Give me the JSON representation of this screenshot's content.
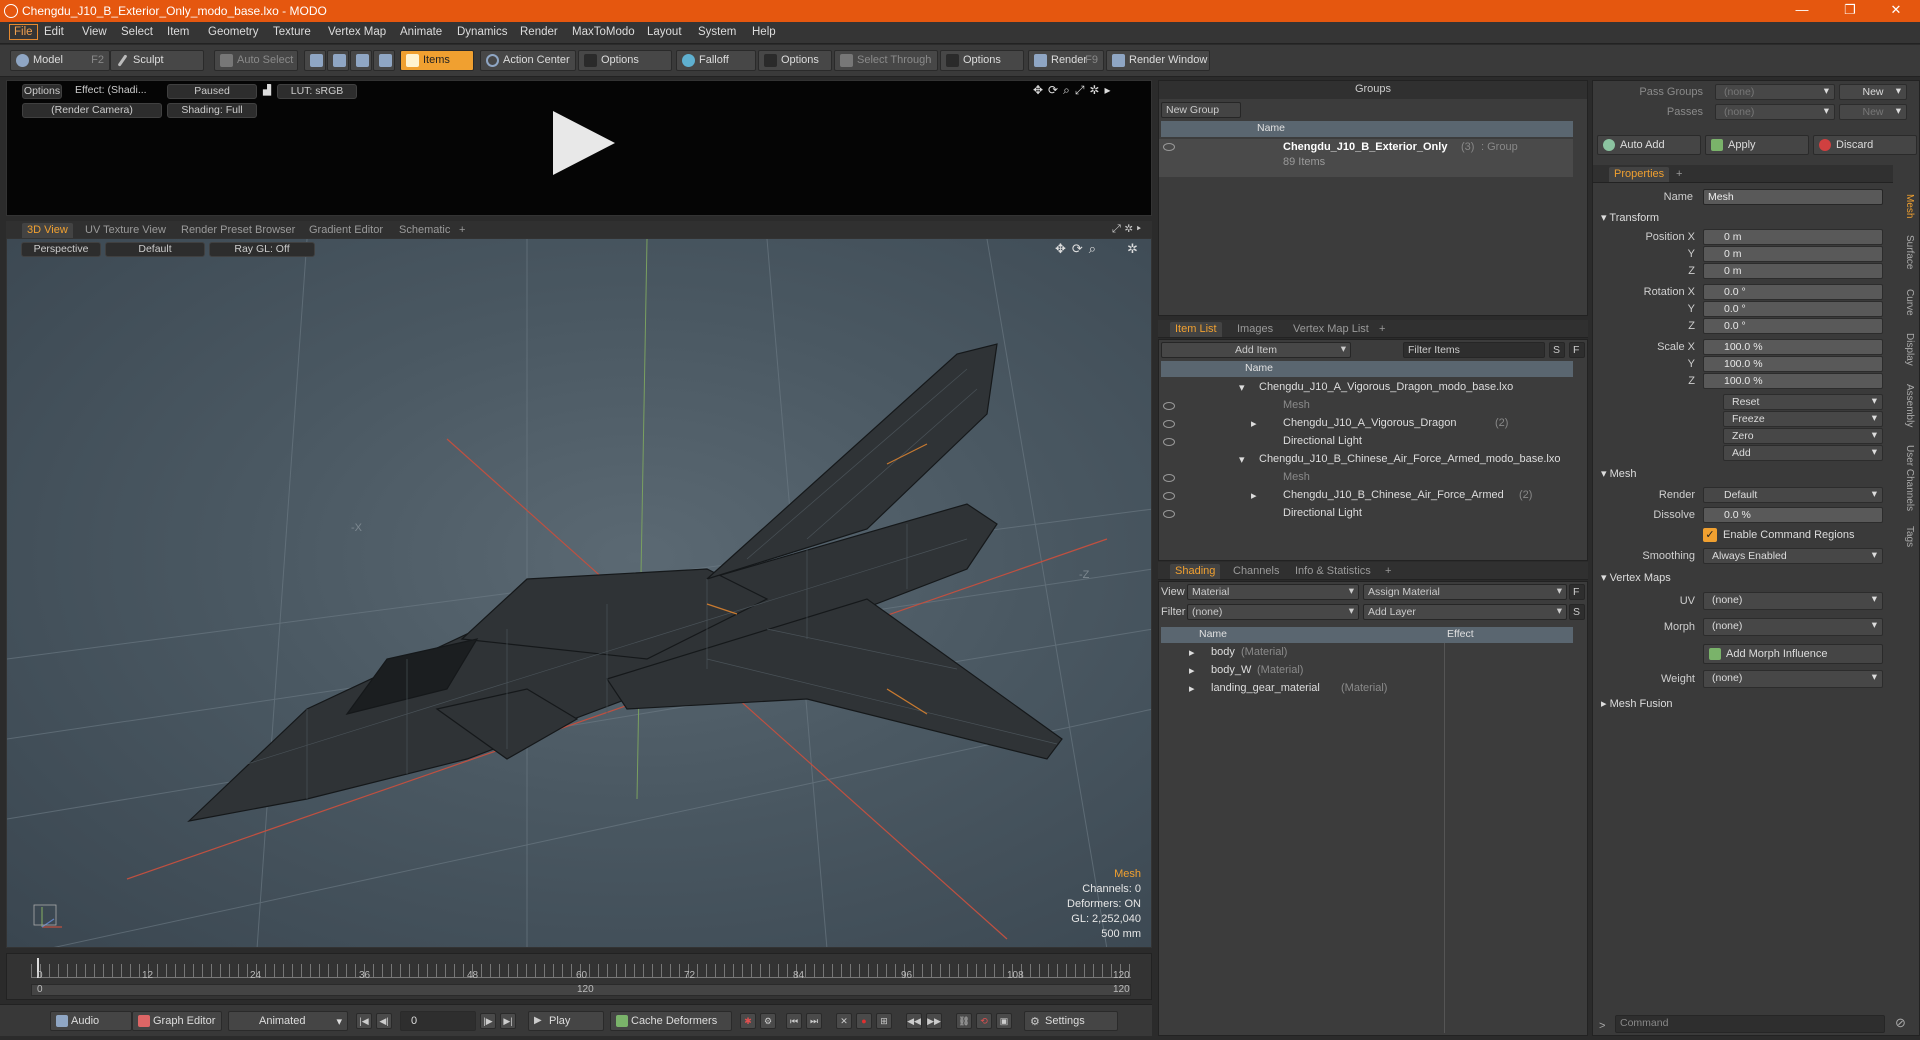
{
  "window": {
    "title": "Chengdu_J10_B_Exterior_Only_modo_base.lxo - MODO",
    "minimize": "—",
    "maximize": "❐",
    "close": "✕"
  },
  "menu": [
    "File",
    "Edit",
    "View",
    "Select",
    "Item",
    "Geometry",
    "Texture",
    "Vertex Map",
    "Animate",
    "Dynamics",
    "Render",
    "MaxToModo",
    "Layout",
    "System",
    "Help"
  ],
  "toolbar": {
    "model": "Model",
    "model_key": "F2",
    "sculpt": "Sculpt",
    "auto_select": "Auto Select",
    "items": "Items",
    "action_center": "Action Center",
    "options1": "Options",
    "falloff": "Falloff",
    "options2": "Options",
    "select_through": "Select Through",
    "options3": "Options",
    "render": "Render",
    "render_key": "F9",
    "render_window": "Render Window"
  },
  "preview": {
    "options": "Options",
    "effect": "Effect: (Shadi...",
    "paused": "Paused",
    "lut": "LUT: sRGB",
    "camera": "(Render Camera)",
    "shading": "Shading: Full"
  },
  "viewport_tabs": [
    "3D View",
    "UV Texture View",
    "Render Preset Browser",
    "Gradient Editor",
    "Schematic",
    "+"
  ],
  "viewport": {
    "perspective": "Perspective",
    "default": "Default",
    "raygl": "Ray GL: Off",
    "axis_x": "-X",
    "axis_z": "-Z",
    "hud_title": "Mesh",
    "hud_channels": "Channels: 0",
    "hud_deformers": "Deformers: ON",
    "hud_gl": "GL: 2,252,040",
    "hud_scale": "500 mm"
  },
  "timeline": {
    "ticks": [
      "0",
      "12",
      "24",
      "36",
      "48",
      "60",
      "72",
      "84",
      "96",
      "108",
      "120"
    ],
    "start": "0",
    "mid": "120",
    "end": "120"
  },
  "bottombar": {
    "audio": "Audio",
    "graph_editor": "Graph Editor",
    "animated": "Animated",
    "frame": "0",
    "play": "Play",
    "cache": "Cache Deformers",
    "settings": "Settings"
  },
  "groups": {
    "header": "Groups",
    "new_group": "New Group",
    "col_name": "Name",
    "item_name": "Chengdu_J10_B_Exterior_Only",
    "item_count": "(3)",
    "item_type": ": Group",
    "item_sub": "89 Items"
  },
  "itemlist": {
    "tabs": [
      "Item List",
      "Images",
      "Vertex Map List",
      "+"
    ],
    "add_item": "Add Item",
    "filter": "Filter Items",
    "s": "S",
    "f": "F",
    "col_name": "Name",
    "rows": [
      {
        "text": "Chengdu_J10_A_Vigorous_Dragon_modo_base.lxo",
        "suffix": ""
      },
      {
        "text": "Mesh",
        "suffix": ""
      },
      {
        "text": "Chengdu_J10_A_Vigorous_Dragon",
        "suffix": "(2)"
      },
      {
        "text": "Directional Light",
        "suffix": ""
      },
      {
        "text": "Chengdu_J10_B_Chinese_Air_Force_Armed_modo_base.lxo",
        "suffix": ""
      },
      {
        "text": "Mesh",
        "suffix": ""
      },
      {
        "text": "Chengdu_J10_B_Chinese_Air_Force_Armed",
        "suffix": "(2)"
      },
      {
        "text": "Directional Light",
        "suffix": ""
      }
    ]
  },
  "shading": {
    "tabs": [
      "Shading",
      "Channels",
      "Info & Statistics",
      "+"
    ],
    "view_label": "View",
    "view_value": "Material",
    "assign": "Assign Material",
    "f": "F",
    "filter_label": "Filter",
    "filter_value": "(none)",
    "add_layer": "Add Layer",
    "s": "S",
    "col_name": "Name",
    "col_effect": "Effect",
    "rows": [
      {
        "name": "body",
        "type": "(Material)"
      },
      {
        "name": "body_W",
        "type": "(Material)"
      },
      {
        "name": "landing_gear_material",
        "type": "(Material)"
      }
    ]
  },
  "props": {
    "pass_groups": "Pass Groups",
    "passes": "Passes",
    "none": "(none)",
    "new": "New",
    "auto_add": "Auto Add",
    "apply": "Apply",
    "discard": "Discard",
    "tab": "Properties",
    "plus": "+",
    "name_label": "Name",
    "name_value": "Mesh",
    "transform": "Transform",
    "pos_label": "Position X",
    "pos_x": "0 m",
    "pos_y": "0 m",
    "pos_z": "0 m",
    "rot_label": "Rotation X",
    "rot_x": "0.0 °",
    "rot_y": "0.0 °",
    "rot_z": "0.0 °",
    "scale_label": "Scale X",
    "scale_x": "100.0 %",
    "scale_y": "100.0 %",
    "scale_z": "100.0 %",
    "y": "Y",
    "z": "Z",
    "reset": "Reset",
    "freeze": "Freeze",
    "zero": "Zero",
    "add": "Add",
    "mesh": "Mesh",
    "render_label": "Render",
    "render_value": "Default",
    "dissolve_label": "Dissolve",
    "dissolve_value": "0.0 %",
    "enable_cmd": "Enable Command Regions",
    "smoothing_label": "Smoothing",
    "smoothing_value": "Always Enabled",
    "vertex_maps": "Vertex Maps",
    "uv_label": "UV",
    "uv_value": "(none)",
    "morph_label": "Morph",
    "morph_value": "(none)",
    "add_morph": "Add Morph Influence",
    "weight_label": "Weight",
    "weight_value": "(none)",
    "mesh_fusion": "Mesh Fusion",
    "vtabs": [
      "Mesh",
      "Surface",
      "Curve",
      "Display",
      "Assembly",
      "User Channels",
      "Tags"
    ]
  },
  "command": {
    "placeholder": "Command"
  }
}
